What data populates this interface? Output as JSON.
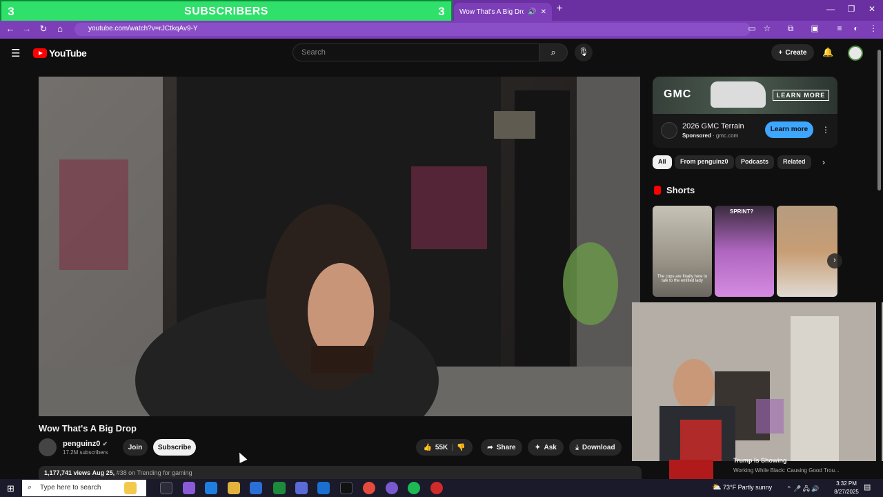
{
  "overlay": {
    "left_count": "3",
    "title": "SUBSCRIBERS",
    "right_count": "3"
  },
  "browser": {
    "tab_title": "Wow That's A Big Drop - Yo",
    "url": "youtube.com/watch?v=rJCtkqAv9-Y"
  },
  "youtube": {
    "logo_text": "YouTube",
    "search_placeholder": "Search",
    "create_label": "Create"
  },
  "video": {
    "title": "Wow That's A Big Drop",
    "channel_name": "penguinz0",
    "channel_subscribers": "17.2M subscribers",
    "join_label": "Join",
    "subscribe_label": "Subscribe",
    "likes": "55K",
    "share_label": "Share",
    "ask_label": "Ask",
    "download_label": "Download",
    "views": "1,177,741 views",
    "date": "Aug 25,",
    "trending": "#38 on Trending for gaming"
  },
  "ad": {
    "banner_brand": "GMC",
    "banner_cta": "LEARN MORE",
    "title": "2026 GMC Terrain",
    "sponsored": "Sponsored",
    "domain": "gmc.com",
    "cta": "Learn more"
  },
  "chips": [
    "All",
    "From penguinz0",
    "Podcasts",
    "Related"
  ],
  "shorts": {
    "title": "Shorts",
    "caption": "The cops are finally here to talk to the entitled lady",
    "label": "SPRINT?"
  },
  "related": {
    "title": "Trump Is Showing",
    "subtitle": "Working While Black: Causing Good Trou..."
  },
  "taskbar": {
    "search_placeholder": "Type here to search",
    "weather": "73°F  Partly sunny",
    "time": "3:32 PM",
    "date": "8/27/2025"
  },
  "colors": {
    "browser_frame": "#6a2fa0",
    "overlay_green": "#2fe06b",
    "yt_red": "#ff0000",
    "learn_more_blue": "#3ea6ff"
  }
}
